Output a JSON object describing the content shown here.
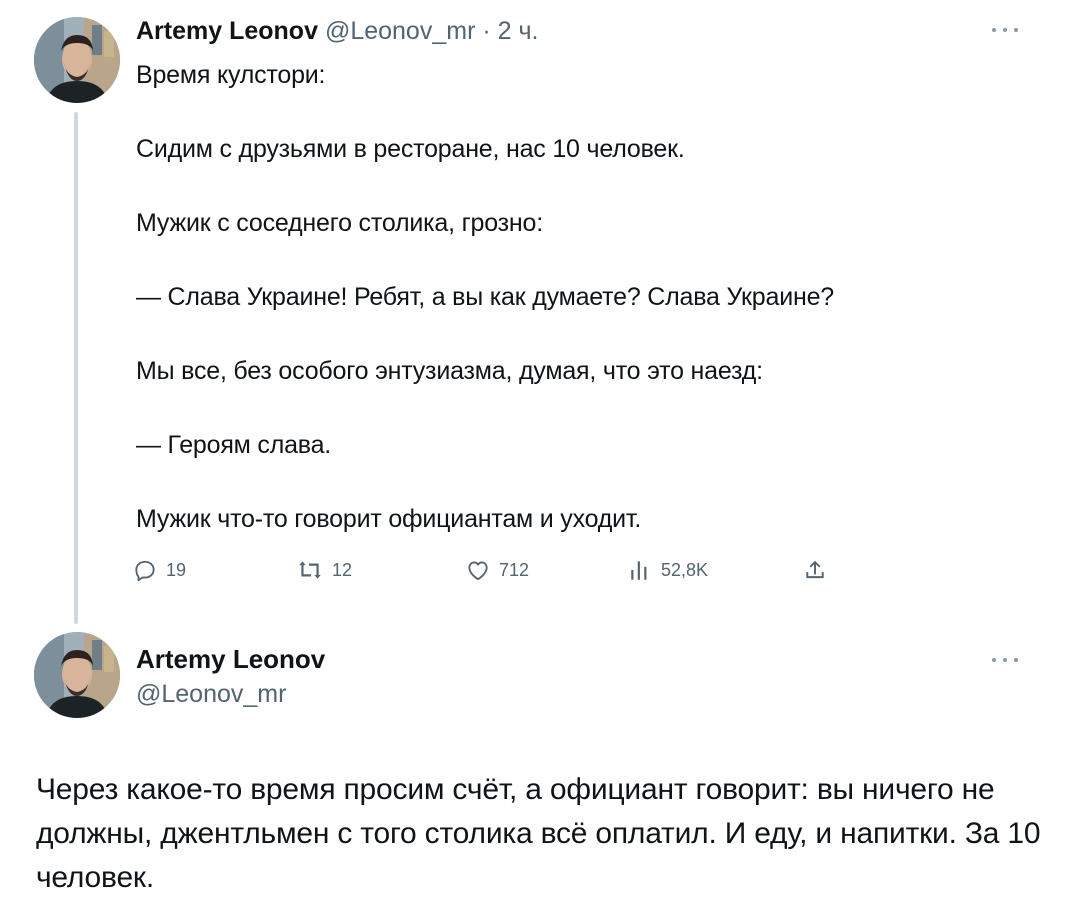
{
  "tweet1": {
    "author_name": "Artemy Leonov",
    "handle": "@Leonov_mr",
    "separator": "·",
    "time": "2 ч.",
    "lines": [
      "Время кулстори:",
      "Сидим с друзьями в ресторане, нас 10 человек.",
      "Мужик с соседнего столика, грозно:",
      "— Слава Украине! Ребят, а вы как думаете? Слава Украине?",
      "Мы все, без особого энтузиазма, думая, что это наезд:",
      "— Героям слава.",
      "Мужик что-то говорит официантам и уходит."
    ],
    "actions": {
      "replies": "19",
      "retweets": "12",
      "likes": "712",
      "views": "52,8K"
    }
  },
  "tweet2": {
    "author_name": "Artemy Leonov",
    "handle": "@Leonov_mr",
    "text": "Через какое-то время просим счёт, а официант говорит: вы ничего не должны, джентльмен с того столика всё оплатил. И еду, и напитки. За 10 человек."
  },
  "icons": {
    "reply": "reply-icon",
    "retweet": "retweet-icon",
    "like": "heart-icon",
    "views": "views-bar-chart-icon",
    "share": "share-icon",
    "more": "more-dots-icon"
  },
  "colors": {
    "text": "#0f1419",
    "muted": "#536471",
    "thread_line": "#cfd9de"
  }
}
